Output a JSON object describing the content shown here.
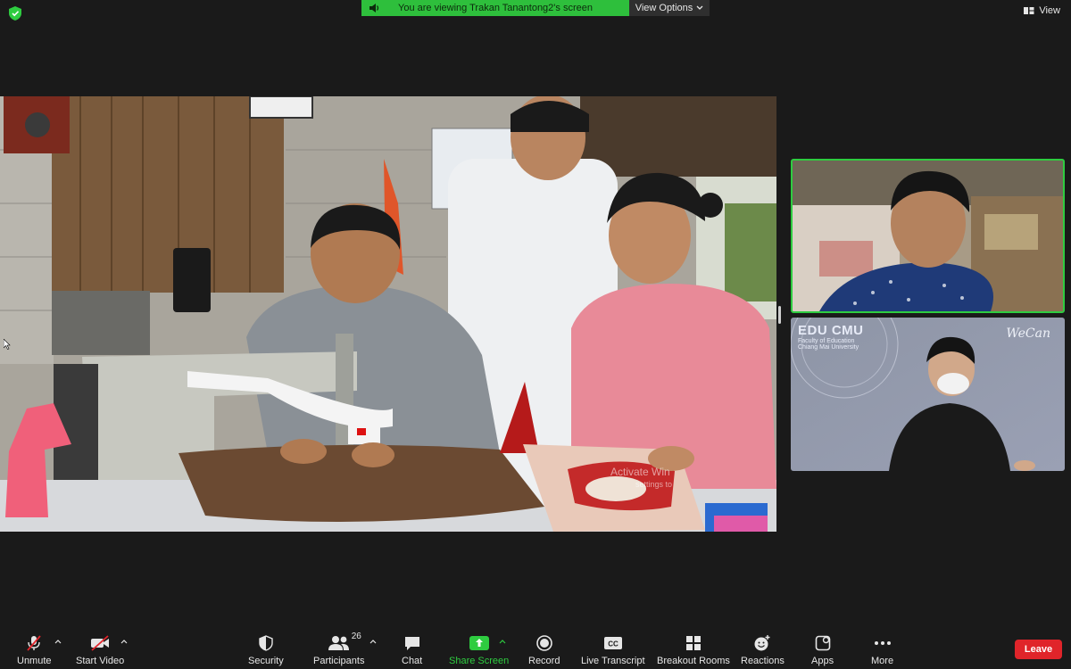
{
  "banner": {
    "text": "You are viewing Trakan Tanantong2's screen"
  },
  "view_options": {
    "label": "View Options"
  },
  "view_button": {
    "label": "View"
  },
  "shared_screen": {
    "watermark_line1": "Activate Win",
    "watermark_line2": "settings to"
  },
  "thumbnails": [
    {
      "id": "participant-1"
    },
    {
      "id": "participant-2",
      "logo": "EDU CMU",
      "logo_sub1": "Faculty of Education",
      "logo_sub2": "Chiang Mai University",
      "brand": "WeCan"
    }
  ],
  "toolbar": {
    "unmute": "Unmute",
    "start_video": "Start Video",
    "security": "Security",
    "participants": "Participants",
    "participants_count": "26",
    "chat": "Chat",
    "share_screen": "Share Screen",
    "record": "Record",
    "live_transcript": "Live Transcript",
    "breakout_rooms": "Breakout Rooms",
    "reactions": "Reactions",
    "apps": "Apps",
    "more": "More",
    "leave": "Leave"
  },
  "colors": {
    "accent_green": "#2ecc40",
    "leave_red": "#e0242a",
    "bar_bg": "#1a1a1a"
  }
}
